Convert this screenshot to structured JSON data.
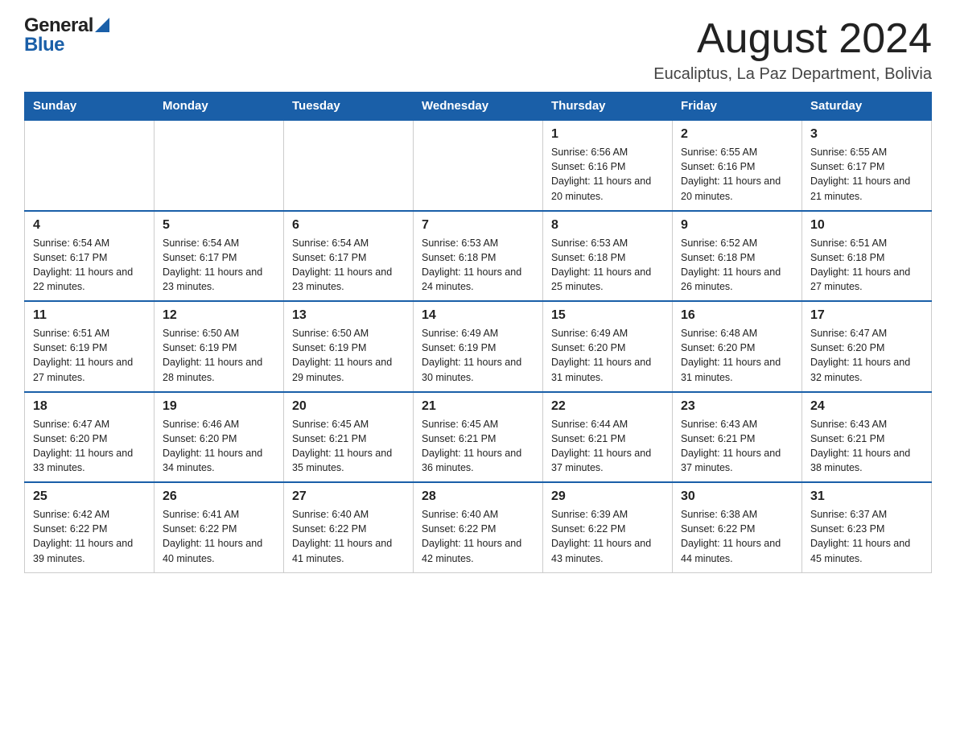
{
  "logo": {
    "general": "General",
    "blue": "Blue"
  },
  "title": "August 2024",
  "subtitle": "Eucaliptus, La Paz Department, Bolivia",
  "days_of_week": [
    "Sunday",
    "Monday",
    "Tuesday",
    "Wednesday",
    "Thursday",
    "Friday",
    "Saturday"
  ],
  "weeks": [
    [
      {
        "day": "",
        "info": ""
      },
      {
        "day": "",
        "info": ""
      },
      {
        "day": "",
        "info": ""
      },
      {
        "day": "",
        "info": ""
      },
      {
        "day": "1",
        "info": "Sunrise: 6:56 AM\nSunset: 6:16 PM\nDaylight: 11 hours and 20 minutes."
      },
      {
        "day": "2",
        "info": "Sunrise: 6:55 AM\nSunset: 6:16 PM\nDaylight: 11 hours and 20 minutes."
      },
      {
        "day": "3",
        "info": "Sunrise: 6:55 AM\nSunset: 6:17 PM\nDaylight: 11 hours and 21 minutes."
      }
    ],
    [
      {
        "day": "4",
        "info": "Sunrise: 6:54 AM\nSunset: 6:17 PM\nDaylight: 11 hours and 22 minutes."
      },
      {
        "day": "5",
        "info": "Sunrise: 6:54 AM\nSunset: 6:17 PM\nDaylight: 11 hours and 23 minutes."
      },
      {
        "day": "6",
        "info": "Sunrise: 6:54 AM\nSunset: 6:17 PM\nDaylight: 11 hours and 23 minutes."
      },
      {
        "day": "7",
        "info": "Sunrise: 6:53 AM\nSunset: 6:18 PM\nDaylight: 11 hours and 24 minutes."
      },
      {
        "day": "8",
        "info": "Sunrise: 6:53 AM\nSunset: 6:18 PM\nDaylight: 11 hours and 25 minutes."
      },
      {
        "day": "9",
        "info": "Sunrise: 6:52 AM\nSunset: 6:18 PM\nDaylight: 11 hours and 26 minutes."
      },
      {
        "day": "10",
        "info": "Sunrise: 6:51 AM\nSunset: 6:18 PM\nDaylight: 11 hours and 27 minutes."
      }
    ],
    [
      {
        "day": "11",
        "info": "Sunrise: 6:51 AM\nSunset: 6:19 PM\nDaylight: 11 hours and 27 minutes."
      },
      {
        "day": "12",
        "info": "Sunrise: 6:50 AM\nSunset: 6:19 PM\nDaylight: 11 hours and 28 minutes."
      },
      {
        "day": "13",
        "info": "Sunrise: 6:50 AM\nSunset: 6:19 PM\nDaylight: 11 hours and 29 minutes."
      },
      {
        "day": "14",
        "info": "Sunrise: 6:49 AM\nSunset: 6:19 PM\nDaylight: 11 hours and 30 minutes."
      },
      {
        "day": "15",
        "info": "Sunrise: 6:49 AM\nSunset: 6:20 PM\nDaylight: 11 hours and 31 minutes."
      },
      {
        "day": "16",
        "info": "Sunrise: 6:48 AM\nSunset: 6:20 PM\nDaylight: 11 hours and 31 minutes."
      },
      {
        "day": "17",
        "info": "Sunrise: 6:47 AM\nSunset: 6:20 PM\nDaylight: 11 hours and 32 minutes."
      }
    ],
    [
      {
        "day": "18",
        "info": "Sunrise: 6:47 AM\nSunset: 6:20 PM\nDaylight: 11 hours and 33 minutes."
      },
      {
        "day": "19",
        "info": "Sunrise: 6:46 AM\nSunset: 6:20 PM\nDaylight: 11 hours and 34 minutes."
      },
      {
        "day": "20",
        "info": "Sunrise: 6:45 AM\nSunset: 6:21 PM\nDaylight: 11 hours and 35 minutes."
      },
      {
        "day": "21",
        "info": "Sunrise: 6:45 AM\nSunset: 6:21 PM\nDaylight: 11 hours and 36 minutes."
      },
      {
        "day": "22",
        "info": "Sunrise: 6:44 AM\nSunset: 6:21 PM\nDaylight: 11 hours and 37 minutes."
      },
      {
        "day": "23",
        "info": "Sunrise: 6:43 AM\nSunset: 6:21 PM\nDaylight: 11 hours and 37 minutes."
      },
      {
        "day": "24",
        "info": "Sunrise: 6:43 AM\nSunset: 6:21 PM\nDaylight: 11 hours and 38 minutes."
      }
    ],
    [
      {
        "day": "25",
        "info": "Sunrise: 6:42 AM\nSunset: 6:22 PM\nDaylight: 11 hours and 39 minutes."
      },
      {
        "day": "26",
        "info": "Sunrise: 6:41 AM\nSunset: 6:22 PM\nDaylight: 11 hours and 40 minutes."
      },
      {
        "day": "27",
        "info": "Sunrise: 6:40 AM\nSunset: 6:22 PM\nDaylight: 11 hours and 41 minutes."
      },
      {
        "day": "28",
        "info": "Sunrise: 6:40 AM\nSunset: 6:22 PM\nDaylight: 11 hours and 42 minutes."
      },
      {
        "day": "29",
        "info": "Sunrise: 6:39 AM\nSunset: 6:22 PM\nDaylight: 11 hours and 43 minutes."
      },
      {
        "day": "30",
        "info": "Sunrise: 6:38 AM\nSunset: 6:22 PM\nDaylight: 11 hours and 44 minutes."
      },
      {
        "day": "31",
        "info": "Sunrise: 6:37 AM\nSunset: 6:23 PM\nDaylight: 11 hours and 45 minutes."
      }
    ]
  ]
}
